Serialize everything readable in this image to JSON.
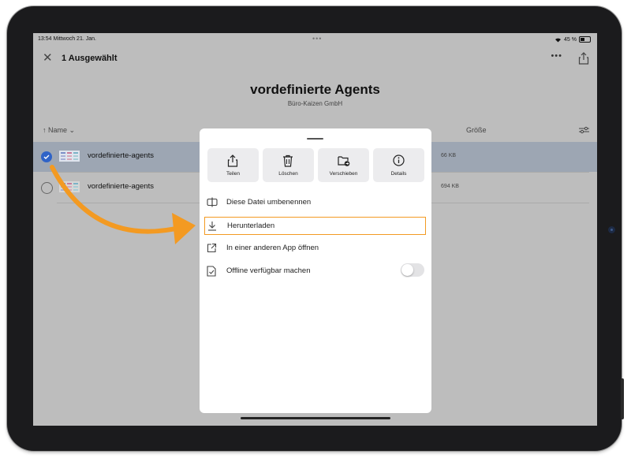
{
  "status": {
    "time": "13:54",
    "date": "Mittwoch 21. Jan.",
    "dots": "•••",
    "battery": "45 %"
  },
  "topbar": {
    "selected": "1 Ausgewählt",
    "more": "•••"
  },
  "header": {
    "title": "vordefinierte Agents",
    "subtitle": "Büro-Kaizen GmbH"
  },
  "columns": {
    "name": "↑ Name ⌄",
    "size": "Größe"
  },
  "files": [
    {
      "name": "vordefinierte-agents",
      "size": "66 KB",
      "selected": true
    },
    {
      "name": "vordefinierte-agents",
      "size": "694 KB",
      "selected": false
    }
  ],
  "sheet": {
    "actions": [
      {
        "label": "Teilen",
        "icon": "share-icon"
      },
      {
        "label": "Löschen",
        "icon": "trash-icon"
      },
      {
        "label": "Verschieben",
        "icon": "folder-move-icon"
      },
      {
        "label": "Details",
        "icon": "info-icon"
      }
    ],
    "menu": [
      {
        "label": "Diese Datei umbenennen",
        "icon": "rename-icon"
      },
      {
        "label": "Herunterladen",
        "icon": "download-icon",
        "highlighted": true
      },
      {
        "label": "In einer anderen App öffnen",
        "icon": "open-external-icon"
      },
      {
        "label": "Offline verfügbar machen",
        "icon": "offline-icon",
        "toggle": false
      }
    ]
  },
  "colors": {
    "accent": "#f39a22",
    "selection": "#2f63c7"
  }
}
